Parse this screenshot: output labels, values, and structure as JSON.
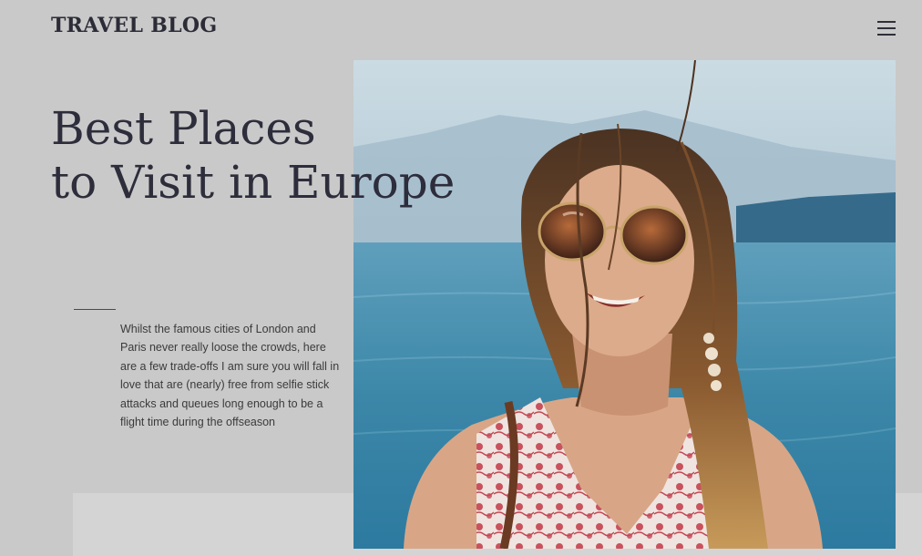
{
  "header": {
    "logo_text": "TRAVEL BLOG",
    "menu_icon": "hamburger-menu-icon"
  },
  "hero": {
    "title_line1": "Best Places",
    "title_line2": "to Visit in Europe",
    "intro_text": "Whilst the famous cities of London and Paris never really loose the crowds, here are a few trade-offs I am sure you will fall in love that are (nearly) free from selfie stick attacks and queues long enough to be a flight time during the offseason"
  },
  "colors": {
    "background": "#c9c9c9",
    "text_dark": "#2d2d3b",
    "sea": "#3e86a6",
    "sky": "#bcd3df"
  }
}
